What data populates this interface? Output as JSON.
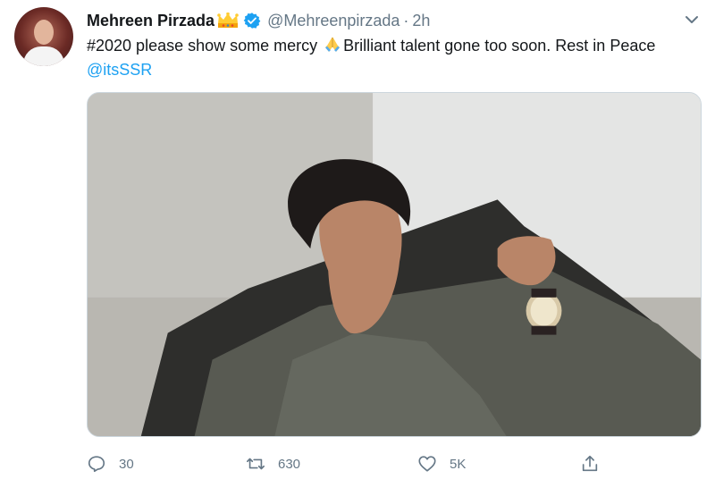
{
  "tweet": {
    "author_name": "Mehreen Pirzada",
    "handle": "@Mehreenpirzada",
    "separator": "·",
    "time": "2h",
    "text_part1": "#2020 please show some mercy ",
    "text_part2": "Brilliant talent gone too soon. Rest in Peace ",
    "mention": "@itsSSR",
    "icons": {
      "crown": "crown-emoji-icon",
      "verified": "verified-badge-icon",
      "pray": "folded-hands-emoji-icon",
      "menu": "chevron-down-icon"
    }
  },
  "actions": {
    "reply_count": "30",
    "retweet_count": "630",
    "like_count": "5K"
  },
  "colors": {
    "link": "#1da1f2",
    "muted": "#657786",
    "verified": "#1da1f2"
  }
}
